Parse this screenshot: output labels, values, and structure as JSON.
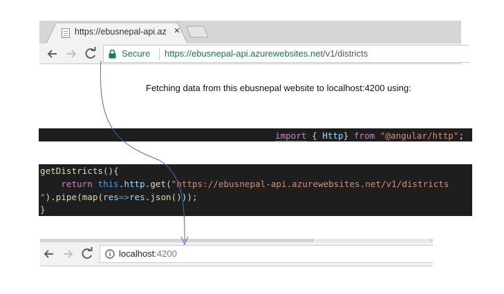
{
  "browser_top": {
    "tab_title": "https://ebusnepal-api.azu",
    "tab_close": "×",
    "secure_label": "Secure",
    "url_host": "https://ebusnepal-api.azurewebsites.net",
    "url_path": "/v1/districts"
  },
  "caption": "Fetching data from this ebusnepal website to localhost:4200 using:",
  "code_import": [
    {
      "text": "import",
      "color": "#c586c0",
      "underline": true
    },
    {
      "text": " { ",
      "color": "#d4d4d4"
    },
    {
      "text": "Http",
      "color": "#9cdcfe"
    },
    {
      "text": "} ",
      "color": "#d4d4d4"
    },
    {
      "text": "from",
      "color": "#c586c0"
    },
    {
      "text": " ",
      "color": "#d4d4d4"
    },
    {
      "text": "\"@angular/http\"",
      "color": "#ce9178"
    },
    {
      "text": ";",
      "color": "#d4d4d4"
    }
  ],
  "code_method": [
    [
      {
        "text": "getDistricts",
        "color": "#dcdcaa"
      },
      {
        "text": "(){",
        "color": "#d4d4d4"
      }
    ],
    [
      {
        "text": "    ",
        "color": "#d4d4d4"
      },
      {
        "text": "return",
        "color": "#c586c0"
      },
      {
        "text": " ",
        "color": "#d4d4d4"
      },
      {
        "text": "this",
        "color": "#569cd6"
      },
      {
        "text": ".",
        "color": "#d4d4d4"
      },
      {
        "text": "http",
        "color": "#9cdcfe"
      },
      {
        "text": ".",
        "color": "#d4d4d4"
      },
      {
        "text": "get",
        "color": "#dcdcaa"
      },
      {
        "text": "(",
        "color": "#d4d4d4"
      },
      {
        "text": "\"https://ebusnepal-api.azurewebsites.net/v1/districts",
        "color": "#ce9178"
      }
    ],
    [
      {
        "text": "\"",
        "color": "#ce9178"
      },
      {
        "text": ").",
        "color": "#d4d4d4"
      },
      {
        "text": "pipe",
        "color": "#dcdcaa"
      },
      {
        "text": "(",
        "color": "#d4d4d4"
      },
      {
        "text": "map",
        "color": "#dcdcaa"
      },
      {
        "text": "(",
        "color": "#d4d4d4"
      },
      {
        "text": "res",
        "color": "#9cdcfe"
      },
      {
        "text": "=>",
        "color": "#569cd6"
      },
      {
        "text": "res",
        "color": "#9cdcfe"
      },
      {
        "text": ".",
        "color": "#d4d4d4"
      },
      {
        "text": "json",
        "color": "#dcdcaa"
      },
      {
        "text": "()));",
        "color": "#d4d4d4"
      }
    ],
    [
      {
        "text": "}",
        "color": "#d4d4d4"
      }
    ]
  ],
  "browser_bottom": {
    "url_host": "localhost",
    "url_port": ":4200"
  },
  "colors": {
    "secure_green": "#0b8043",
    "arrow": "#3f6fb0",
    "code_bg": "#1e1e1e"
  }
}
